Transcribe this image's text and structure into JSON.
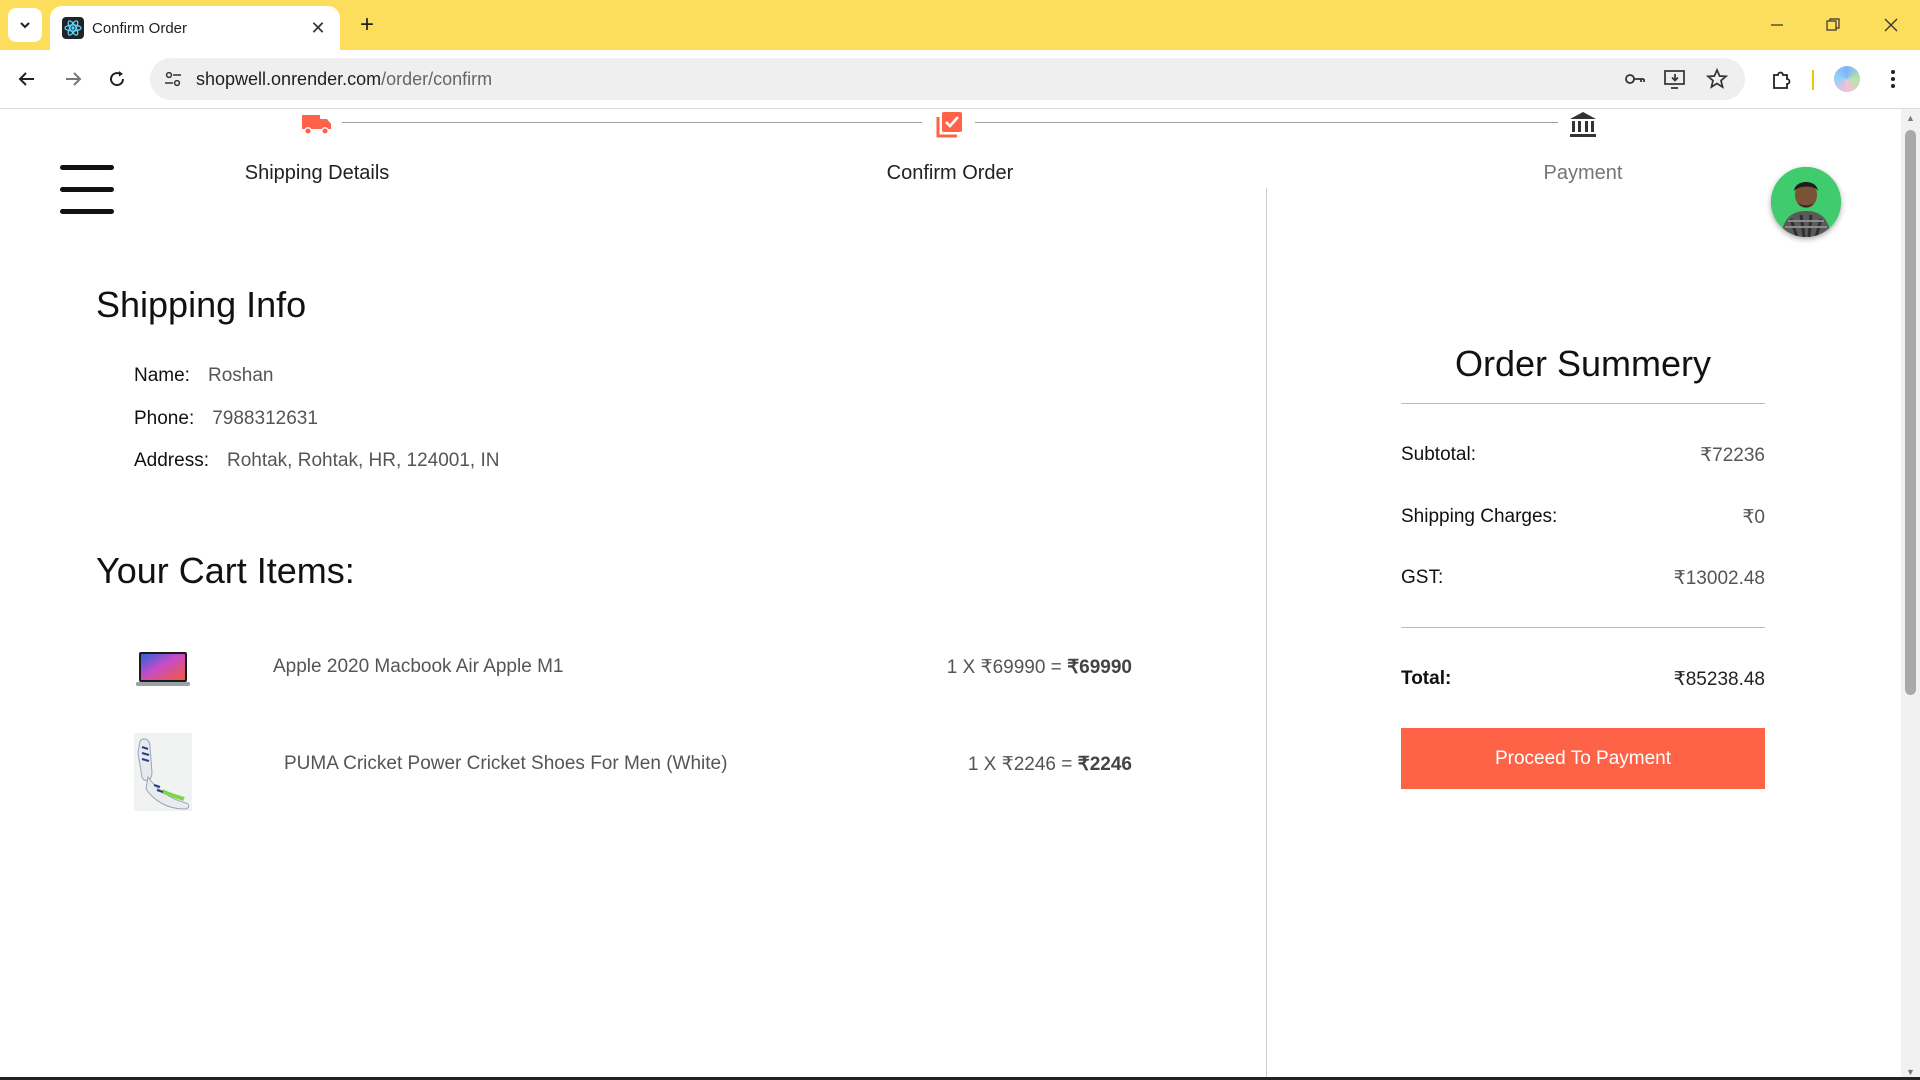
{
  "browser": {
    "tab_title": "Confirm Order",
    "url_host": "shopwell.onrender.com",
    "url_path": "/order/confirm",
    "icons": {
      "tab_dropdown": "chevron-down-icon",
      "favicon": "react-icon",
      "tab_close": "close-icon",
      "new_tab": "plus-icon",
      "minimize": "minimize-icon",
      "restore": "restore-icon",
      "close_window": "close-icon",
      "back": "arrow-left-icon",
      "forward": "arrow-right-icon",
      "reload": "reload-icon",
      "site_info": "tune-icon",
      "password": "key-icon",
      "install": "install-icon",
      "bookmark": "star-icon",
      "extensions": "puzzle-icon",
      "profile": "profile-icon",
      "menu": "more-vert-icon"
    }
  },
  "stepper": {
    "steps": [
      {
        "label": "Shipping Details",
        "icon": "truck-icon",
        "active": true
      },
      {
        "label": "Confirm Order",
        "icon": "checklist-icon",
        "active": true
      },
      {
        "label": "Payment",
        "icon": "bank-icon",
        "active": false
      }
    ],
    "active_color": "#ff6347"
  },
  "shipping": {
    "heading": "Shipping Info",
    "name_label": "Name:",
    "name_value": "Roshan",
    "phone_label": "Phone:",
    "phone_value": "7988312631",
    "address_label": "Address:",
    "address_value": "Rohtak, Rohtak, HR, 124001, IN"
  },
  "cart": {
    "heading": "Your Cart Items:",
    "items": [
      {
        "name": "Apple 2020 Macbook Air Apple M1",
        "qty_price": "1 X ₹69990 = ",
        "total": "₹69990",
        "thumb": "laptop-image"
      },
      {
        "name": "PUMA Cricket Power Cricket Shoes For Men (White)",
        "qty_price": "1 X ₹2246 = ",
        "total": "₹2246",
        "thumb": "shoe-image"
      }
    ]
  },
  "summary": {
    "title": "Order Summery",
    "subtotal_label": "Subtotal:",
    "subtotal_value": "₹72236",
    "shipping_label": "Shipping Charges:",
    "shipping_value": "₹0",
    "gst_label": "GST:",
    "gst_value": "₹13002.48",
    "total_label": "Total:",
    "total_value": "₹85238.48",
    "button_label": "Proceed To Payment",
    "button_color": "#ff6347"
  },
  "theme": {
    "tabbar_color": "#fddd5c",
    "accent": "#ff6347"
  }
}
